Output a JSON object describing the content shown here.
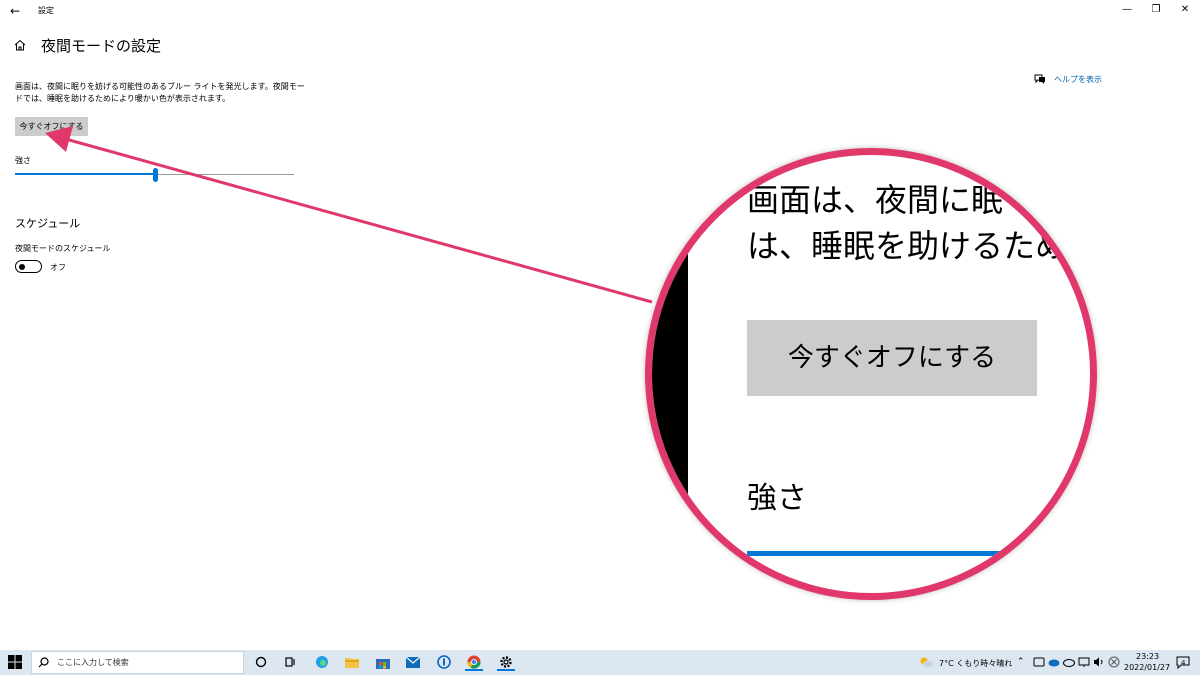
{
  "window": {
    "title": "設定",
    "back_glyph": "←",
    "minimize_glyph": "—",
    "restore_glyph": "❐",
    "close_glyph": "✕"
  },
  "page": {
    "title": "夜間モードの設定",
    "help_label": "ヘルプを表示",
    "description": "画面は、夜間に眠りを妨げる可能性のあるブルー ライトを発光します。夜間モードでは、睡眠を助けるためにより暖かい色が表示されます。",
    "off_button_label": "今すぐオフにする",
    "strength_label": "強さ",
    "strength_value_percent": 50,
    "schedule_heading": "スケジュール",
    "schedule_toggle_label": "夜間モードのスケジュール",
    "schedule_toggle_state": "オフ",
    "schedule_toggle_on": false
  },
  "zoom": {
    "line1": "画面は、夜間に眠",
    "line2": "は、睡眠を助けるために",
    "button_label": "今すぐオフにする",
    "strength_label": "強さ"
  },
  "taskbar": {
    "search_placeholder": "ここに入力して検索",
    "weather": "7°C くもり時々晴れ",
    "time": "23:23",
    "date": "2022/01/27",
    "notification_count": "4"
  },
  "colors": {
    "accent": "#0078d7",
    "annotation": "#e0386a",
    "button_bg": "#cccccc",
    "link": "#0063b1"
  },
  "icons": [
    "back-arrow-icon",
    "home-icon",
    "help-chat-icon",
    "windows-start-icon",
    "search-icon",
    "cortana-icon",
    "task-view-icon",
    "edge-icon",
    "file-explorer-icon",
    "store-icon",
    "mail-icon",
    "password-manager-icon",
    "chrome-icon",
    "settings-gear-icon",
    "weather-icon",
    "chevron-up-icon",
    "network-icon",
    "speaker-icon",
    "notification-icon"
  ]
}
